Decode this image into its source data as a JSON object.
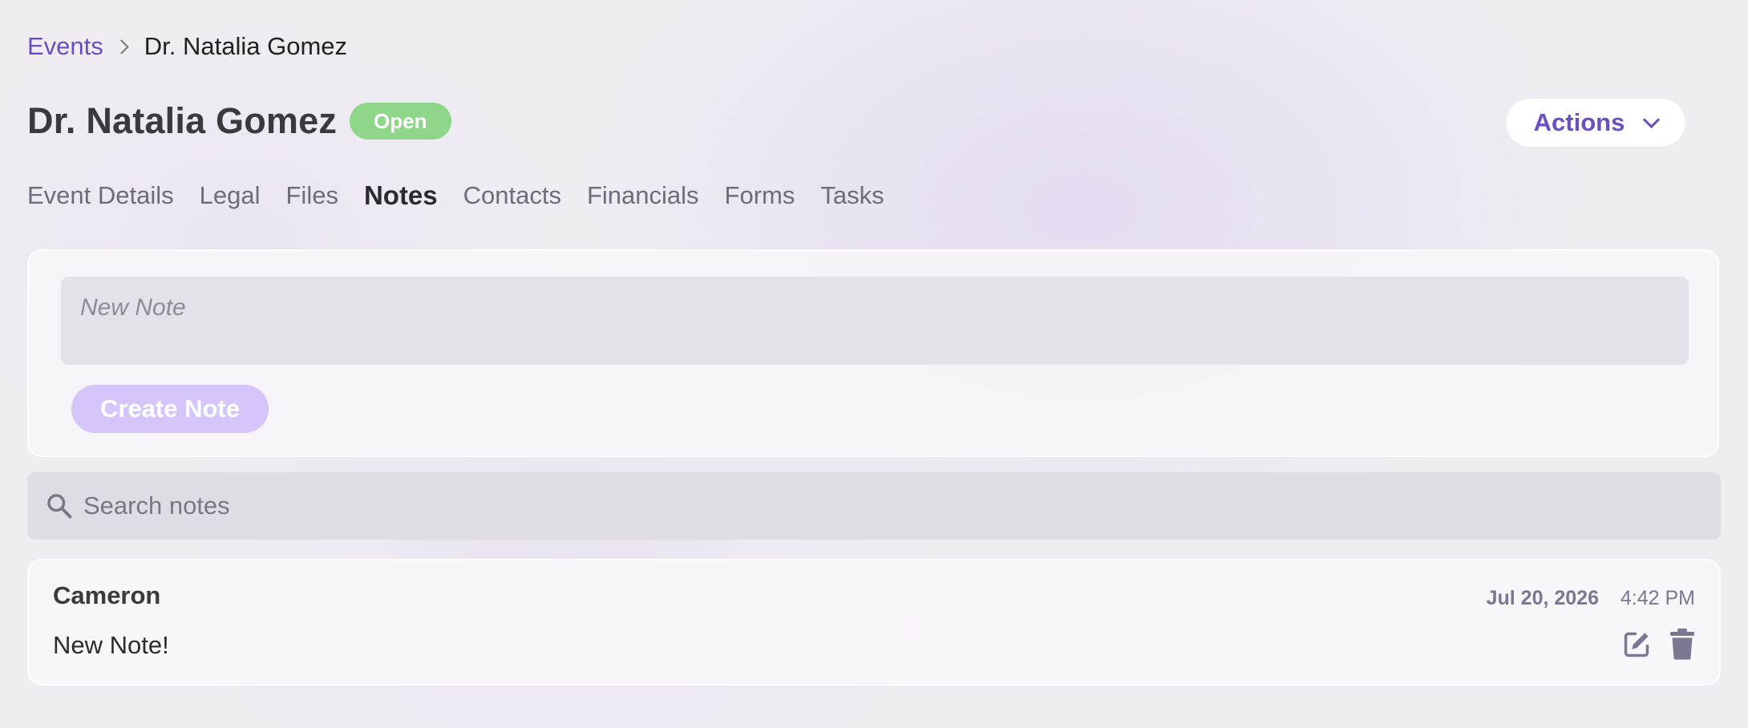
{
  "breadcrumb": {
    "parent": "Events",
    "current": "Dr. Natalia Gomez"
  },
  "header": {
    "title": "Dr. Natalia Gomez",
    "status": "Open",
    "actions_label": "Actions"
  },
  "tabs": [
    {
      "label": "Event Details",
      "active": false
    },
    {
      "label": "Legal",
      "active": false
    },
    {
      "label": "Files",
      "active": false
    },
    {
      "label": "Notes",
      "active": true
    },
    {
      "label": "Contacts",
      "active": false
    },
    {
      "label": "Financials",
      "active": false
    },
    {
      "label": "Forms",
      "active": false
    },
    {
      "label": "Tasks",
      "active": false
    }
  ],
  "new_note": {
    "value": "",
    "placeholder": "New Note",
    "create_label": "Create Note"
  },
  "search": {
    "value": "",
    "placeholder": "Search notes"
  },
  "notes": [
    {
      "author": "Cameron",
      "body": "New Note!",
      "date": "Jul 20, 2026",
      "time": "4:42 PM"
    }
  ],
  "colors": {
    "accent": "#6a4fc0",
    "status_open": "#8fd58a",
    "create_button": "#d6c5fb",
    "icon": "#7a7891"
  },
  "icons": {
    "search": "search-icon",
    "edit": "edit-icon",
    "delete": "trash-icon",
    "actions": "chevron-down-icon",
    "breadcrumb_separator": "chevron-right-icon"
  }
}
